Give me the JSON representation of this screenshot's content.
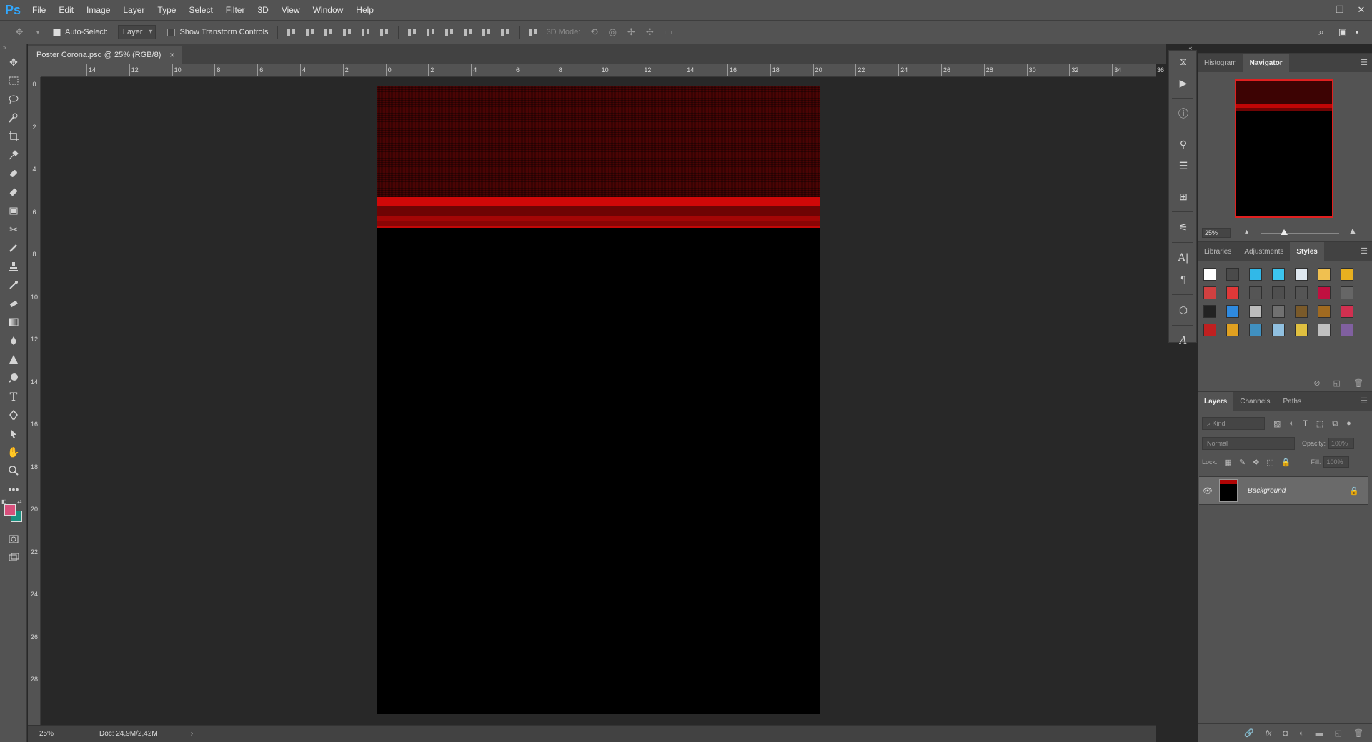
{
  "app": {
    "logo": "Ps"
  },
  "menu": [
    "File",
    "Edit",
    "Image",
    "Layer",
    "Type",
    "Select",
    "Filter",
    "3D",
    "View",
    "Window",
    "Help"
  ],
  "window_controls": [
    "–",
    "❐",
    "✕"
  ],
  "options": {
    "auto_select_label": "Auto-Select:",
    "auto_select_value": "Layer",
    "transform_label": "Show Transform Controls",
    "mode_3d_label": "3D Mode:"
  },
  "document": {
    "tab_title": "Poster Corona.psd @ 25% (RGB/8)",
    "close_glyph": "×"
  },
  "rulers": {
    "top": [
      "14",
      "12",
      "10",
      "8",
      "6",
      "4",
      "2",
      "0",
      "2",
      "4",
      "6",
      "8",
      "10",
      "12",
      "14",
      "16",
      "18",
      "20",
      "22",
      "24",
      "26",
      "28",
      "30",
      "32",
      "34",
      "36"
    ],
    "left": [
      "0",
      "2",
      "4",
      "6",
      "8",
      "10",
      "12",
      "14",
      "16",
      "18",
      "20",
      "22",
      "24",
      "26",
      "28"
    ]
  },
  "status": {
    "zoom": "25%",
    "doc_info": "Doc: 24,9M/2,42M",
    "arrow": "›"
  },
  "navigator": {
    "tabs": [
      "Histogram",
      "Navigator"
    ],
    "active": "Navigator",
    "zoom": "25%",
    "zoom_level": 0.3
  },
  "styles_panel": {
    "tabs": [
      "Libraries",
      "Adjustments",
      "Styles"
    ],
    "active": "Styles",
    "swatches": [
      "#ffffff",
      "#4a4a4a",
      "#31b8e8",
      "#3cc6f0",
      "#dfe8f0",
      "#f0c050",
      "#e8b020",
      "#d04040",
      "#e03838",
      "#555555",
      "#4f4f4f",
      "#555555",
      "#c01040",
      "#666666",
      "#222222",
      "#2e8ae0",
      "#bbbbbb",
      "#707070",
      "#7a5a2a",
      "#a06a20",
      "#d03050",
      "#c02020",
      "#e0a020",
      "#4090c0",
      "#90c0e0",
      "#e0c040",
      "#c0c0c0",
      "#8060a0"
    ]
  },
  "layers_panel": {
    "tabs": [
      "Layers",
      "Channels",
      "Paths"
    ],
    "active": "Layers",
    "filter_placeholder": "⌕ Kind",
    "blend_mode": "Normal",
    "opacity_label": "Opacity:",
    "opacity_value": "100%",
    "lock_label": "Lock:",
    "fill_label": "Fill:",
    "fill_value": "100%",
    "layers": [
      {
        "name": "Background"
      }
    ]
  },
  "colors": {
    "foreground": "#d84f7b",
    "background": "#1a9080",
    "guide": "#36c3d0",
    "ps_blue": "#31a8ff"
  }
}
